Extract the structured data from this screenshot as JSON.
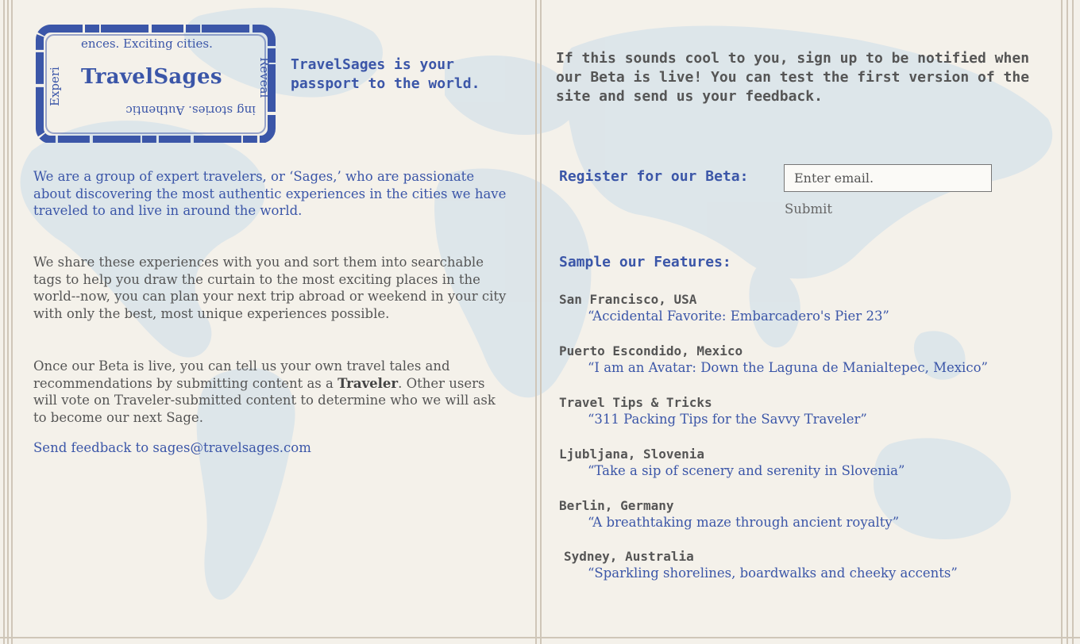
{
  "colors": {
    "accent": "#3b56a8",
    "text": "#555555",
    "paper": "#f4f1ea",
    "map": "#d9e3ea"
  },
  "stamp": {
    "title": "TravelSages",
    "top_text": "ences. Exciting cities.",
    "left_text": "Experi",
    "bottom_text": "ing stories. Authentic",
    "right_text": "Reveal"
  },
  "tagline": "TravelSages is your passport to the world.",
  "intro": "We are a group of expert travelers, or ‘Sages,’ who are passionate about discovering the most authentic experiences in the cities we have traveled to and live in around the world.",
  "para2": "We share these experiences with you and sort them into searchable tags to help you draw the curtain to the most exciting places in the world--now, you can plan your next trip abroad or weekend in your city with only the best, most unique experiences possible.",
  "para3": {
    "before": "Once our Beta is live, you can tell us your own travel tales and recommendations by submitting content as a ",
    "bold": "Traveler",
    "after": ". Other users will vote on Traveler-submitted content to determine who we will ask to become our next Sage."
  },
  "feedback": "Send feedback to sages@travelsages.com",
  "signup": "If this sounds cool to you, sign up to be notified when our Beta is live! You can test the first version of the site and send us your feedback.",
  "register": {
    "label": "Register for our Beta:",
    "placeholder": "Enter email.",
    "submit": "Submit"
  },
  "sample_title": "Sample our Features:",
  "features": [
    {
      "location": "San Francisco, USA",
      "story": "“Accidental Favorite: Embarcadero's Pier 23”"
    },
    {
      "location": "Puerto Escondido, Mexico",
      "story": "“I am an Avatar: Down the Laguna de Manialtepec, Mexico”"
    },
    {
      "location": "Travel Tips & Tricks",
      "story": "“311 Packing Tips for the Savvy Traveler”"
    },
    {
      "location": "Ljubljana, Slovenia",
      "story": "“Take a sip of scenery and serenity in Slovenia”"
    },
    {
      "location": "Berlin, Germany",
      "story": "“A breathtaking maze through ancient royalty”"
    },
    {
      "location": "Sydney, Australia",
      "story": "“Sparkling shorelines, boardwalks and cheeky accents”"
    }
  ]
}
